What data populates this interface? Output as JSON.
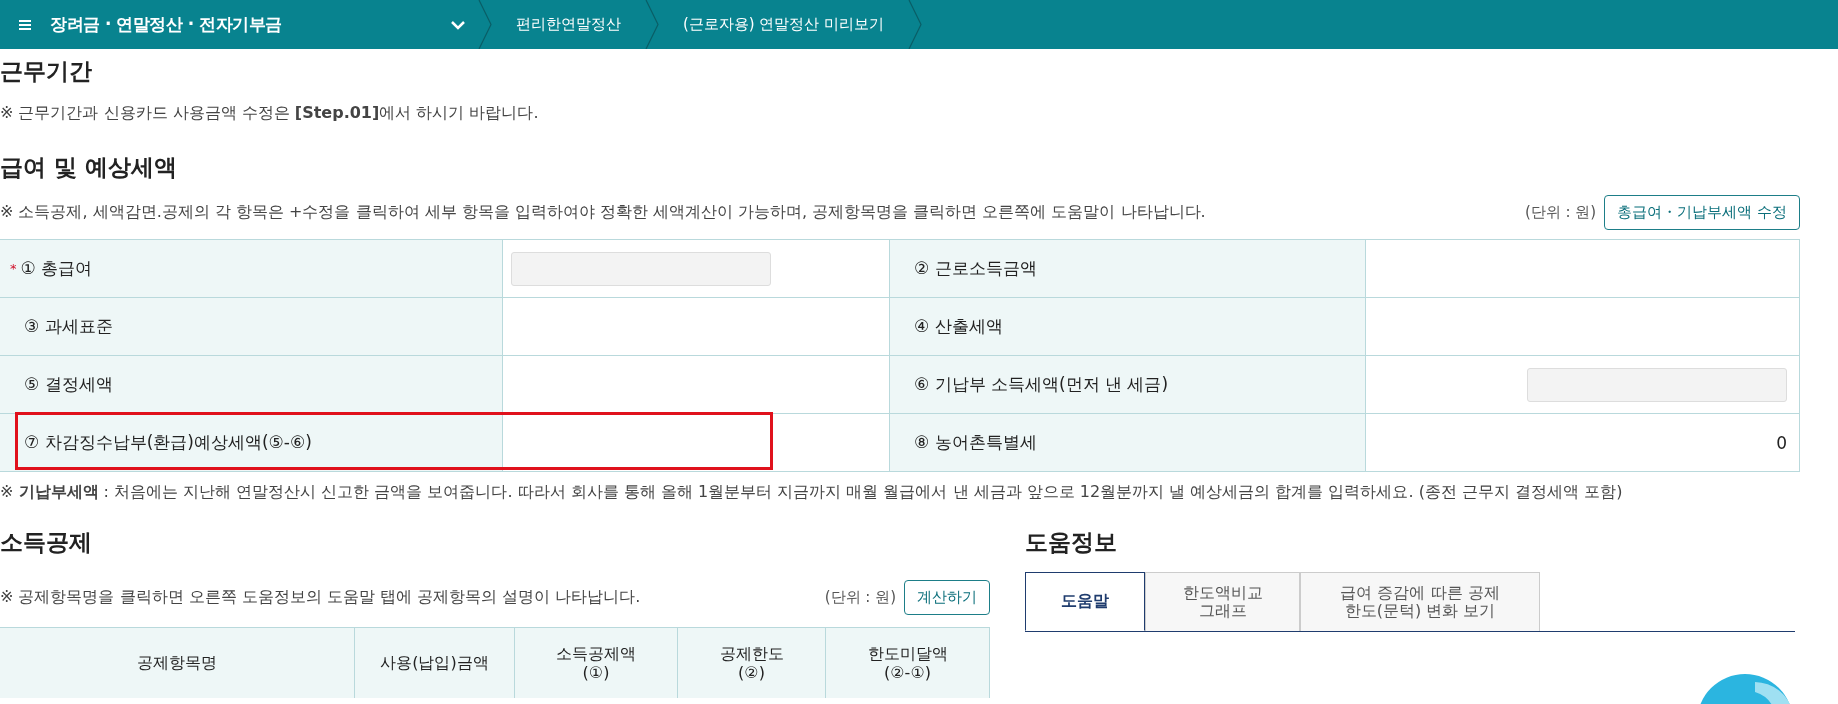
{
  "nav": {
    "title": "장려금 · 연말정산 · 전자기부금",
    "crumbs": [
      "편리한연말정산",
      "(근로자용) 연말정산 미리보기"
    ]
  },
  "work_period": {
    "heading": "근무기간",
    "note": "※ 근무기간과 신용카드 사용금액 수정은 **[Step.01]**에서 하시기 바랍니다."
  },
  "salary": {
    "heading": "급여 및 예상세액",
    "note": "※ 소득공제, 세액감면.공제의 각 항목은 +수정을 클릭하여 세부 항목을 입력하여야 정확한 세액계산이 가능하며, 공제항목명을 클릭하면 오른쪽에 도움말이 나타납니다.",
    "unit": "(단위 : 원)",
    "button": "총급여・기납부세액 수정",
    "items": [
      {
        "marker": "*",
        "label": "① 총급여",
        "kind": "input",
        "highlighted": false
      },
      {
        "label": "② 근로소득금액",
        "kind": "blank",
        "highlighted": false
      },
      {
        "label": "③ 과세표준",
        "kind": "blank",
        "highlighted": false
      },
      {
        "label": "④ 산출세액",
        "kind": "blank",
        "highlighted": false
      },
      {
        "label": "⑤ 결정세액",
        "kind": "blank",
        "highlighted": false
      },
      {
        "label": "⑥ 기납부 소득세액(먼저 낸 세금)",
        "kind": "input",
        "highlighted": false
      },
      {
        "label": "⑦ 차감징수납부(환급)예상세액(⑤-⑥)",
        "kind": "blank",
        "highlighted": true
      },
      {
        "label": "⑧ 농어촌특별세",
        "kind": "value",
        "value": "0",
        "highlighted": false
      }
    ],
    "footnote": "※ **기납부세액** : 처음에는 지난해 연말정산시 신고한 금액을 보여줍니다. 따라서 회사를 통해 올해 1월분부터 지금까지 매월 월급에서 낸 세금과 앞으로 12월분까지 낼 예상세금의 합계를 입력하세요. (종전 근무지 결정세액 포함)"
  },
  "deductions": {
    "heading": "소득공제",
    "note": "※ 공제항목명을 클릭하면 오른쪽 도움정보의 도움말 탭에 공제항목의 설명이 나타납니다.",
    "unit": "(단위 : 원)",
    "button": "계산하기",
    "columns": [
      "공제항목명",
      "사용(납입)금액",
      "소득공제액\n(①)",
      "공제한도\n(②)",
      "한도미달액\n(②-①)"
    ]
  },
  "help": {
    "heading": "도움정보",
    "tabs": [
      {
        "label": "도움말",
        "selected": true
      },
      {
        "label": "한도액비교\n그래프",
        "selected": false
      },
      {
        "label": "급여 증감에 따른 공제\n한도(문턱) 변화 보기",
        "selected": false
      }
    ]
  }
}
